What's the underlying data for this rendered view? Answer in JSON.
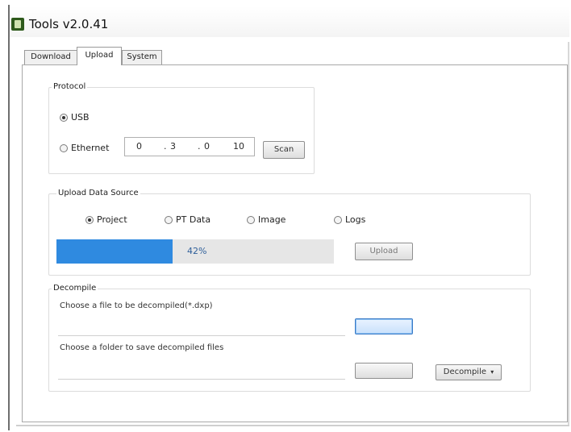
{
  "window": {
    "title": "Tools v2.0.41"
  },
  "tabs": [
    {
      "label": "Download",
      "active": false
    },
    {
      "label": "Upload",
      "active": true
    },
    {
      "label": "System",
      "active": false
    }
  ],
  "protocol": {
    "legend": "Protocol",
    "usb_label": "USB",
    "usb_selected": true,
    "ethernet_label": "Ethernet",
    "ethernet_selected": false,
    "ip": [
      "0",
      "3",
      "0",
      "10"
    ],
    "scan_label": "Scan"
  },
  "upload_data_source": {
    "legend": "Upload Data Source",
    "options": [
      {
        "label": "Project",
        "selected": true
      },
      {
        "label": "PT Data",
        "selected": false
      },
      {
        "label": "Image",
        "selected": false
      },
      {
        "label": "Logs",
        "selected": false
      }
    ],
    "progress_percent": 42,
    "progress_text": "42%",
    "upload_label": "Upload"
  },
  "decompile": {
    "legend": "Decompile",
    "file_prompt": "Choose a file to be decompiled(*.dxp)",
    "file_value": "",
    "file_button_label": "",
    "folder_prompt": "Choose a folder to save decompiled files",
    "folder_value": "",
    "folder_button_label": "",
    "decompile_label": "Decompile"
  },
  "colors": {
    "progress_fill": "#2f8ae0",
    "progress_track": "#e6e6e6",
    "focused_button": "#4a90d9"
  }
}
